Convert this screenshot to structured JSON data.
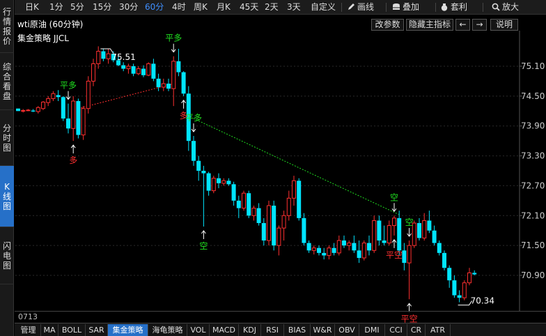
{
  "left_tabs": [
    {
      "label": "行情报价",
      "active": false
    },
    {
      "label": "综合看盘",
      "active": false
    },
    {
      "label": "分时图",
      "active": false
    },
    {
      "label": "K线图",
      "active": true
    },
    {
      "label": "闪电图",
      "active": false
    }
  ],
  "toolbar": {
    "periods": [
      "日K",
      "1分",
      "5分",
      "15分",
      "30分",
      "60分",
      "4时",
      "周K",
      "月K",
      "45天",
      "2天",
      "3天",
      "自定义"
    ],
    "active_period": "60分",
    "draw_label": "画线",
    "overlay_label": "叠加",
    "profit_label": "套利",
    "zoom_label": "放大"
  },
  "info": {
    "title": "wti原油 (60分钟)",
    "param_label": "改参数",
    "hide_label": "隐藏主指标",
    "left_arrow": "←",
    "right_arrow": "→",
    "help_label": "说明",
    "strategy_label": "集金策略 JJCL"
  },
  "chart_data": {
    "type": "candlestick",
    "y_ticks": [
      "75.10",
      "74.50",
      "73.90",
      "73.30",
      "72.70",
      "72.10",
      "71.50",
      "70.90"
    ],
    "ylim": [
      70.18,
      75.78
    ],
    "candles": [
      [
        74.25,
        74.25,
        74.2,
        74.2
      ],
      [
        74.2,
        74.24,
        74.17,
        74.21
      ],
      [
        74.22,
        74.24,
        74.2,
        74.22
      ],
      [
        74.21,
        74.24,
        74.18,
        74.19
      ],
      [
        74.19,
        74.3,
        74.15,
        74.27
      ],
      [
        74.25,
        74.4,
        74.22,
        74.38
      ],
      [
        74.37,
        74.5,
        74.3,
        74.45
      ],
      [
        74.45,
        74.6,
        74.4,
        74.55
      ],
      [
        74.52,
        74.62,
        74.4,
        74.48
      ],
      [
        74.48,
        74.5,
        74.0,
        74.05
      ],
      [
        74.05,
        74.35,
        73.75,
        73.85
      ],
      [
        73.85,
        74.5,
        73.6,
        74.4
      ],
      [
        74.4,
        74.45,
        73.65,
        73.72
      ],
      [
        73.72,
        74.3,
        73.62,
        74.25
      ],
      [
        74.25,
        74.9,
        74.15,
        74.8
      ],
      [
        74.8,
        75.25,
        74.7,
        75.15
      ],
      [
        75.15,
        75.5,
        75.05,
        75.4
      ],
      [
        75.4,
        75.45,
        75.2,
        75.25
      ],
      [
        75.25,
        75.45,
        75.15,
        75.35
      ],
      [
        75.35,
        75.4,
        75.18,
        75.22
      ],
      [
        75.22,
        75.35,
        75.1,
        75.12
      ],
      [
        75.12,
        75.18,
        75.0,
        75.05
      ],
      [
        75.05,
        75.15,
        74.95,
        75.1
      ],
      [
        75.1,
        75.15,
        74.9,
        74.95
      ],
      [
        74.95,
        75.1,
        74.92,
        75.05
      ],
      [
        75.05,
        75.12,
        74.88,
        74.92
      ],
      [
        74.92,
        75.18,
        74.9,
        75.15
      ],
      [
        75.15,
        75.25,
        74.8,
        74.85
      ],
      [
        74.85,
        74.95,
        74.6,
        74.68
      ],
      [
        74.68,
        74.85,
        74.6,
        74.75
      ],
      [
        74.75,
        74.85,
        74.6,
        74.65
      ],
      [
        74.65,
        75.3,
        74.3,
        75.2
      ],
      [
        75.2,
        75.45,
        74.9,
        74.98
      ],
      [
        74.98,
        75.0,
        74.5,
        74.55
      ],
      [
        74.55,
        74.7,
        73.4,
        73.6
      ],
      [
        73.6,
        73.7,
        73.1,
        73.2
      ],
      [
        73.2,
        73.3,
        72.8,
        73.0
      ],
      [
        73.0,
        73.1,
        71.88,
        72.95
      ],
      [
        72.95,
        72.98,
        72.5,
        72.6
      ],
      [
        72.6,
        72.9,
        72.55,
        72.85
      ],
      [
        72.85,
        72.95,
        72.65,
        72.75
      ],
      [
        72.75,
        72.85,
        72.7,
        72.8
      ],
      [
        72.8,
        72.85,
        72.7,
        72.73
      ],
      [
        72.73,
        72.78,
        72.3,
        72.4
      ],
      [
        72.4,
        72.5,
        72.05,
        72.25
      ],
      [
        72.25,
        72.6,
        72.2,
        72.55
      ],
      [
        72.55,
        72.6,
        72.05,
        72.1
      ],
      [
        72.1,
        72.3,
        72.0,
        72.25
      ],
      [
        72.25,
        72.35,
        71.9,
        71.95
      ],
      [
        71.95,
        72.05,
        71.5,
        71.6
      ],
      [
        71.6,
        72.4,
        71.5,
        72.3
      ],
      [
        72.3,
        72.4,
        71.4,
        71.5
      ],
      [
        71.5,
        71.9,
        71.3,
        71.85
      ],
      [
        71.85,
        72.2,
        71.6,
        72.1
      ],
      [
        72.1,
        72.6,
        72.0,
        72.45
      ],
      [
        72.45,
        72.9,
        72.3,
        72.8
      ],
      [
        72.8,
        72.85,
        72.0,
        72.05
      ],
      [
        72.05,
        72.15,
        71.5,
        71.55
      ],
      [
        71.55,
        71.6,
        71.35,
        71.4
      ],
      [
        71.4,
        71.5,
        71.32,
        71.45
      ],
      [
        71.45,
        71.5,
        71.3,
        71.35
      ],
      [
        71.35,
        71.45,
        71.22,
        71.3
      ],
      [
        71.3,
        71.5,
        71.22,
        71.45
      ],
      [
        71.45,
        71.55,
        71.3,
        71.35
      ],
      [
        71.35,
        71.7,
        71.3,
        71.6
      ],
      [
        71.6,
        71.7,
        71.45,
        71.5
      ],
      [
        71.5,
        71.6,
        71.4,
        71.55
      ],
      [
        71.55,
        71.7,
        71.35,
        71.4
      ],
      [
        71.4,
        71.6,
        71.15,
        71.25
      ],
      [
        71.25,
        71.6,
        71.2,
        71.55
      ],
      [
        71.55,
        71.7,
        71.3,
        71.4
      ],
      [
        71.4,
        72.1,
        71.35,
        72.0
      ],
      [
        72.0,
        72.1,
        71.5,
        71.6
      ],
      [
        71.6,
        71.9,
        71.5,
        71.55
      ],
      [
        71.55,
        72.0,
        71.5,
        71.9
      ],
      [
        71.9,
        72.1,
        71.7,
        72.05
      ],
      [
        72.05,
        72.2,
        71.3,
        71.4
      ],
      [
        71.4,
        71.55,
        71.0,
        71.15
      ],
      [
        71.15,
        71.6,
        70.42,
        71.5
      ],
      [
        71.5,
        72.0,
        71.45,
        71.95
      ],
      [
        71.95,
        72.05,
        71.6,
        71.65
      ],
      [
        71.65,
        72.15,
        71.6,
        72.0
      ],
      [
        72.0,
        72.2,
        71.75,
        71.8
      ],
      [
        71.8,
        71.9,
        71.5,
        71.55
      ],
      [
        71.55,
        71.6,
        71.3,
        71.35
      ],
      [
        71.35,
        71.4,
        71.0,
        71.05
      ],
      [
        71.05,
        71.1,
        70.65,
        70.8
      ],
      [
        70.8,
        70.9,
        70.45,
        70.5
      ],
      [
        70.5,
        70.6,
        70.36,
        70.45
      ],
      [
        70.45,
        70.8,
        70.4,
        70.75
      ],
      [
        70.75,
        71.05,
        70.7,
        70.95
      ],
      [
        70.95,
        71.0,
        70.9,
        70.92
      ]
    ],
    "trend_lines": [
      {
        "from": [
          12,
          74.25
        ],
        "to": [
          31,
          74.75
        ],
        "color": "#ff3030"
      },
      {
        "from": [
          35,
          74.05
        ],
        "to": [
          76,
          72.12
        ],
        "color": "#20e020"
      }
    ],
    "signals": [
      {
        "index": 10,
        "label": "平多",
        "color": "#20e020",
        "position": "above"
      },
      {
        "index": 11,
        "label": "多",
        "color": "#ff3030",
        "position": "below"
      },
      {
        "index": 31,
        "label": "平多",
        "color": "#20e020",
        "position": "above"
      },
      {
        "index": 33,
        "label": "多",
        "color": "#ff3030",
        "position": "below"
      },
      {
        "index": 35,
        "label": "平多",
        "color": "#20e020",
        "position": "above"
      },
      {
        "index": 37,
        "label": "空",
        "color": "#20e020",
        "position": "below"
      },
      {
        "index": 75,
        "label": "空",
        "color": "#20e020",
        "position": "above"
      },
      {
        "index": 75,
        "label": "平空",
        "color": "#ff3030",
        "position": "below"
      },
      {
        "index": 78,
        "label": "空",
        "color": "#20e020",
        "position": "above"
      },
      {
        "index": 78,
        "label": "平空",
        "color": "#ff3030",
        "position": "below"
      }
    ],
    "high_label": {
      "index": 17,
      "value": "75.51"
    },
    "low_label": {
      "index": 88,
      "value": "70.34"
    },
    "colors": {
      "up": "#ff3030",
      "down": "#00e5ff",
      "axis": "#555555"
    }
  },
  "date_label": "0713",
  "bottom_tabs": [
    {
      "label": "管理",
      "active": false
    },
    {
      "label": "MA",
      "active": false
    },
    {
      "label": "BOLL",
      "active": false
    },
    {
      "label": "SAR",
      "active": false
    },
    {
      "label": "集金策略",
      "active": true
    },
    {
      "label": "海龟策略",
      "active": false
    },
    {
      "label": "VOL",
      "active": false
    },
    {
      "label": "MACD",
      "active": false
    },
    {
      "label": "KDJ",
      "active": false
    },
    {
      "label": "RSI",
      "active": false
    },
    {
      "label": "BIAS",
      "active": false
    },
    {
      "label": "W&R",
      "active": false
    },
    {
      "label": "OBV",
      "active": false
    },
    {
      "label": "DMI",
      "active": false
    },
    {
      "label": "CCI",
      "active": false
    },
    {
      "label": "CR",
      "active": false
    },
    {
      "label": "ATR",
      "active": false
    }
  ]
}
